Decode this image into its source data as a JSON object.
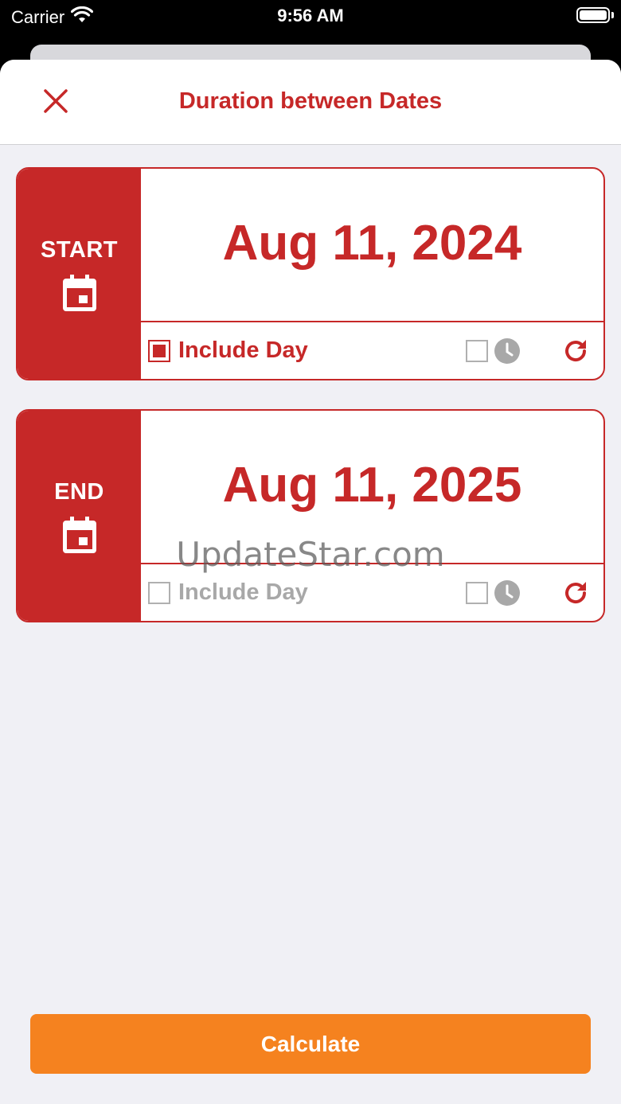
{
  "status_bar": {
    "carrier": "Carrier",
    "time": "9:56 AM"
  },
  "nav": {
    "title": "Duration between Dates",
    "close_icon": "close-icon"
  },
  "start_card": {
    "label": "START",
    "date": "Aug 11, 2024",
    "include_day_label": "Include Day",
    "include_day_checked": true,
    "time_enabled": false
  },
  "end_card": {
    "label": "END",
    "date": "Aug 11, 2025",
    "include_day_label": "Include Day",
    "include_day_checked": false,
    "time_enabled": false
  },
  "watermark": "UpdateStar.com",
  "calculate_label": "Calculate",
  "colors": {
    "primary_red": "#c62828",
    "accent_orange": "#f5821f",
    "background": "#f0f0f5",
    "disabled_gray": "#a8a8a8"
  }
}
